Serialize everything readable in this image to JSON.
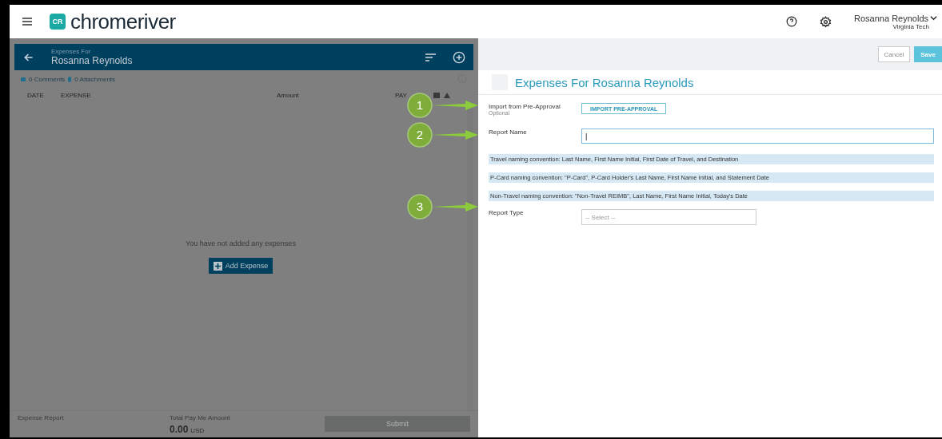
{
  "header": {
    "logo_mark": "CR",
    "logo": "chromeriver",
    "user": "Rosanna Reynolds",
    "org": "Virginia Tech"
  },
  "left_panel": {
    "subtitle": "Expenses For",
    "title": "Rosanna Reynolds",
    "comments": "0 Comments",
    "attachments": "0 Attachments",
    "columns": [
      "DATE",
      "EXPENSE",
      "Amount",
      "PAY"
    ],
    "empty_message": "You have not added any expenses",
    "add_button": "Add Expense",
    "footer": {
      "label": "Expense Report",
      "total_label": "Total Pay Me Amount",
      "total": "0.00",
      "currency": "USD",
      "submit": "Submit",
      "submit_disabled": true
    }
  },
  "right_panel": {
    "cancel": "Cancel",
    "save": "Save",
    "title": "Expenses For Rosanna Reynolds",
    "fields": [
      {
        "kind": "button",
        "label": "Import from Pre-Approval",
        "hint": "Optional",
        "value": "IMPORT PRE-APPROVAL"
      },
      {
        "kind": "input",
        "label": "Report Name",
        "value": "|"
      }
    ],
    "notes": [
      "Travel naming convention: Last Name, First Name Initial, First Date of Travel, and Destination",
      "P-Card naming convention: \"P-Card\", P-Card Holder's Last Name, First Name Initial, and Statement Date",
      "Non-Travel naming convention: \"Non-Travel REIMB\", Last Name, First Name Initial, Today's Date"
    ],
    "fields_after": [
      {
        "kind": "select",
        "label": "Report Type",
        "placeholder": "-- Select --"
      }
    ]
  },
  "callouts": [
    "1",
    "2",
    "3"
  ]
}
